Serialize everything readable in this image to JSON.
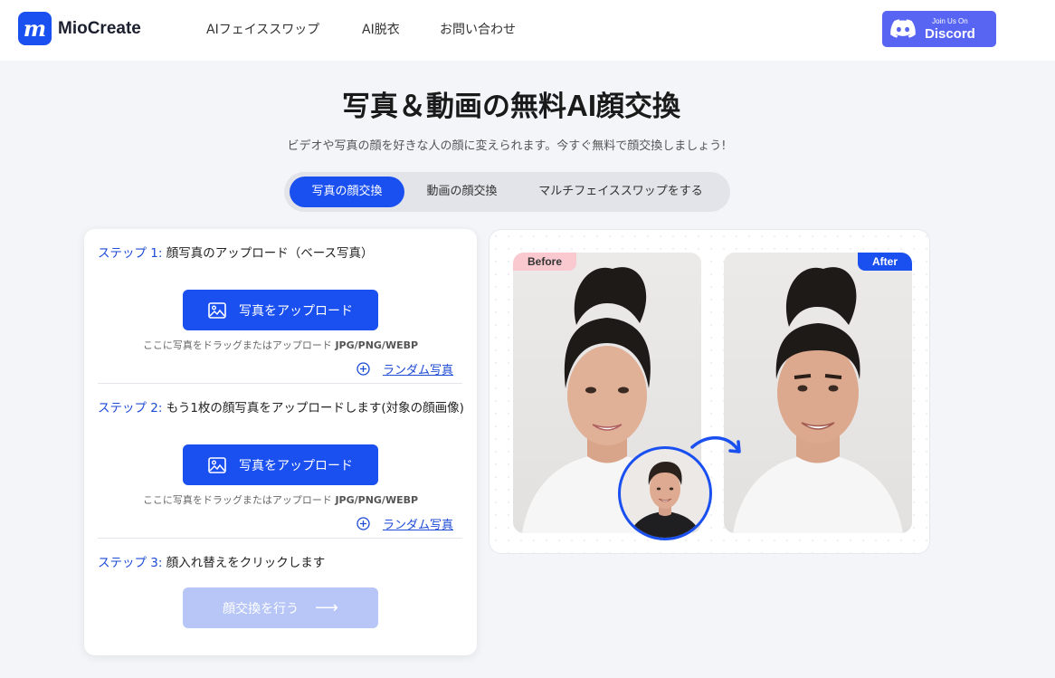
{
  "header": {
    "brand": "MioCreate",
    "logo_letter": "m",
    "nav": [
      "AIフェイススワップ",
      "AI脱衣",
      "お問い合わせ"
    ],
    "discord_small": "Join Us On",
    "discord_big": "Discord"
  },
  "hero": {
    "title_pre": "写真＆動画の無料",
    "title_ai": "AI",
    "title_post": "顔交換",
    "subtitle": "ビデオや写真の顔を好きな人の顔に変えられます。今すぐ無料で顔交換しましょう!"
  },
  "tabs": [
    {
      "label": "写真の顔交換",
      "active": true
    },
    {
      "label": "動画の顔交換",
      "active": false
    },
    {
      "label": "マルチフェイススワップをする",
      "active": false
    }
  ],
  "steps": [
    {
      "num": "ステップ 1:",
      "text": " 顔写真のアップロード（ベース写真）",
      "button": "写真をアップロード",
      "hint": "ここに写真をドラッグまたはアップロード",
      "formats": "JPG/PNG/WEBP",
      "random": "ランダム写真"
    },
    {
      "num": "ステップ 2:",
      "text": " もう1枚の顔写真をアップロードします(対象の顔画像)",
      "button": "写真をアップロード",
      "hint": "ここに写真をドラッグまたはアップロード",
      "formats": "JPG/PNG/WEBP",
      "random": "ランダム写真"
    },
    {
      "num": "ステップ 3:",
      "text": " 顔入れ替えをクリックします",
      "button": "顔交換を行う",
      "arrow": "⟶"
    }
  ],
  "preview": {
    "before_label": "Before",
    "after_label": "After"
  },
  "colors": {
    "accent": "#1a4ff0",
    "discord": "#5865f2",
    "disabled_button": "#b7c6f6",
    "before_badge": "#f9c9cf"
  }
}
